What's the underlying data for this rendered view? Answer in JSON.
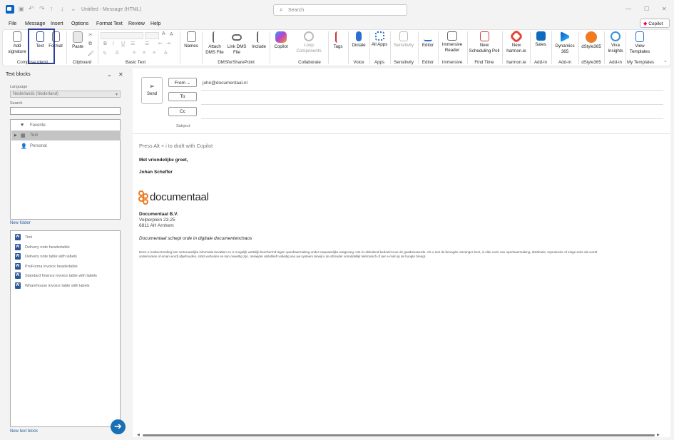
{
  "window": {
    "title": "Untitled - Message (HTML)",
    "search_placeholder": "Search",
    "copilot_label": "Copilot"
  },
  "menu": [
    "File",
    "Message",
    "Insert",
    "Options",
    "Format Text",
    "Review",
    "Help"
  ],
  "ribbon": {
    "buttons": {
      "add_signature": "Add signature",
      "text": "Text",
      "format": "Format",
      "paste": "Paste",
      "names": "Names",
      "attach_dms": "Attach DMS File",
      "link_dms": "Link DMS File",
      "include": "Include",
      "copilot": "Copilot",
      "loop": "Loop Components",
      "tags": "Tags",
      "dictate": "Dictate",
      "all_apps": "All Apps",
      "sensitivity": "Sensitivity",
      "editor": "Editor",
      "immersive_reader": "Immersive Reader",
      "new_poll": "New Scheduling Poll",
      "new_harmon": "New harmon.ie",
      "sales": "Sales",
      "dynamics": "Dynamics 365",
      "dstyle": "dStyle365",
      "viva": "Viva Insights",
      "view_templates": "View Templates"
    },
    "groups": {
      "compose": "Compose identi...",
      "clipboard": "Clipboard",
      "basic_text": "Basic Text",
      "dms": "DMSforSharePoint",
      "collaborate": "Collaborate",
      "voice": "Voice",
      "apps": "Apps",
      "sensitivity": "Sensitivity",
      "editor": "Editor",
      "immersive": "Immersive",
      "find_time": "Find Time",
      "harmon": "harmon.ie",
      "addin1": "Add-in",
      "addin2": "Add-in",
      "dstyle": "dStyle365",
      "addin3": "Add-in",
      "my_templates": "My Templates"
    }
  },
  "text_blocks_pane": {
    "title": "Text blocks",
    "language_label": "Language",
    "language_value": "Nederlands (Nederland)",
    "search_label": "Search",
    "folders": [
      "Favorite",
      "Text",
      "Personal"
    ],
    "selected_folder": "Text",
    "new_folder": "New folder",
    "blocks": [
      "Text",
      "Delivery note headertable",
      "Delivery note table with labels",
      "ProForma invoice headertable",
      "Standard finance invoice table with labels",
      "Wharehouse invoice table with labels"
    ],
    "new_text_block": "New text block"
  },
  "compose": {
    "send": "Send",
    "from_label": "From",
    "from_value": "john@documentaal.nl",
    "to_label": "To",
    "cc_label": "Cc",
    "subject_label": "Subject",
    "hint": "Press Alt + i to draft with Copilot",
    "greeting": "Met vriendelijke groet,",
    "sender_name": "Johan Scheffer",
    "logo_text": "documentaal",
    "company": "Documentaal B.V.",
    "address1": "Velperplein 23-25",
    "address2": "6811 AH  Arnhem",
    "tagline": "Documentaal schept orde in digitale documentenchaos",
    "disclaimer": "Deze e-mailverzending kan vertrouwelijke informatie bevatten en is mogelijk wettelijk beschermd tegen openbaarmaking onder toepasselijke wetgeving. Het is uitsluitend bedoeld voor de geadresseerde. Als u niet de beoogde ontvanger bent, is elke vorm van openbaarmaking, distributie, reproductie of enige actie die wordt ondernomen of ervan wordt afgehouden, strikt verboden en kan onwettig zijn. Verwijder alstublieft volledig van uw systeem terwijl u de afzender onmiddellijk telefonisch of per e-mail op de hoogte brengt."
  },
  "colors": {
    "accent": "#2c3f9a",
    "brand_orange": "#f07b22",
    "link_blue": "#2a5d9f"
  }
}
